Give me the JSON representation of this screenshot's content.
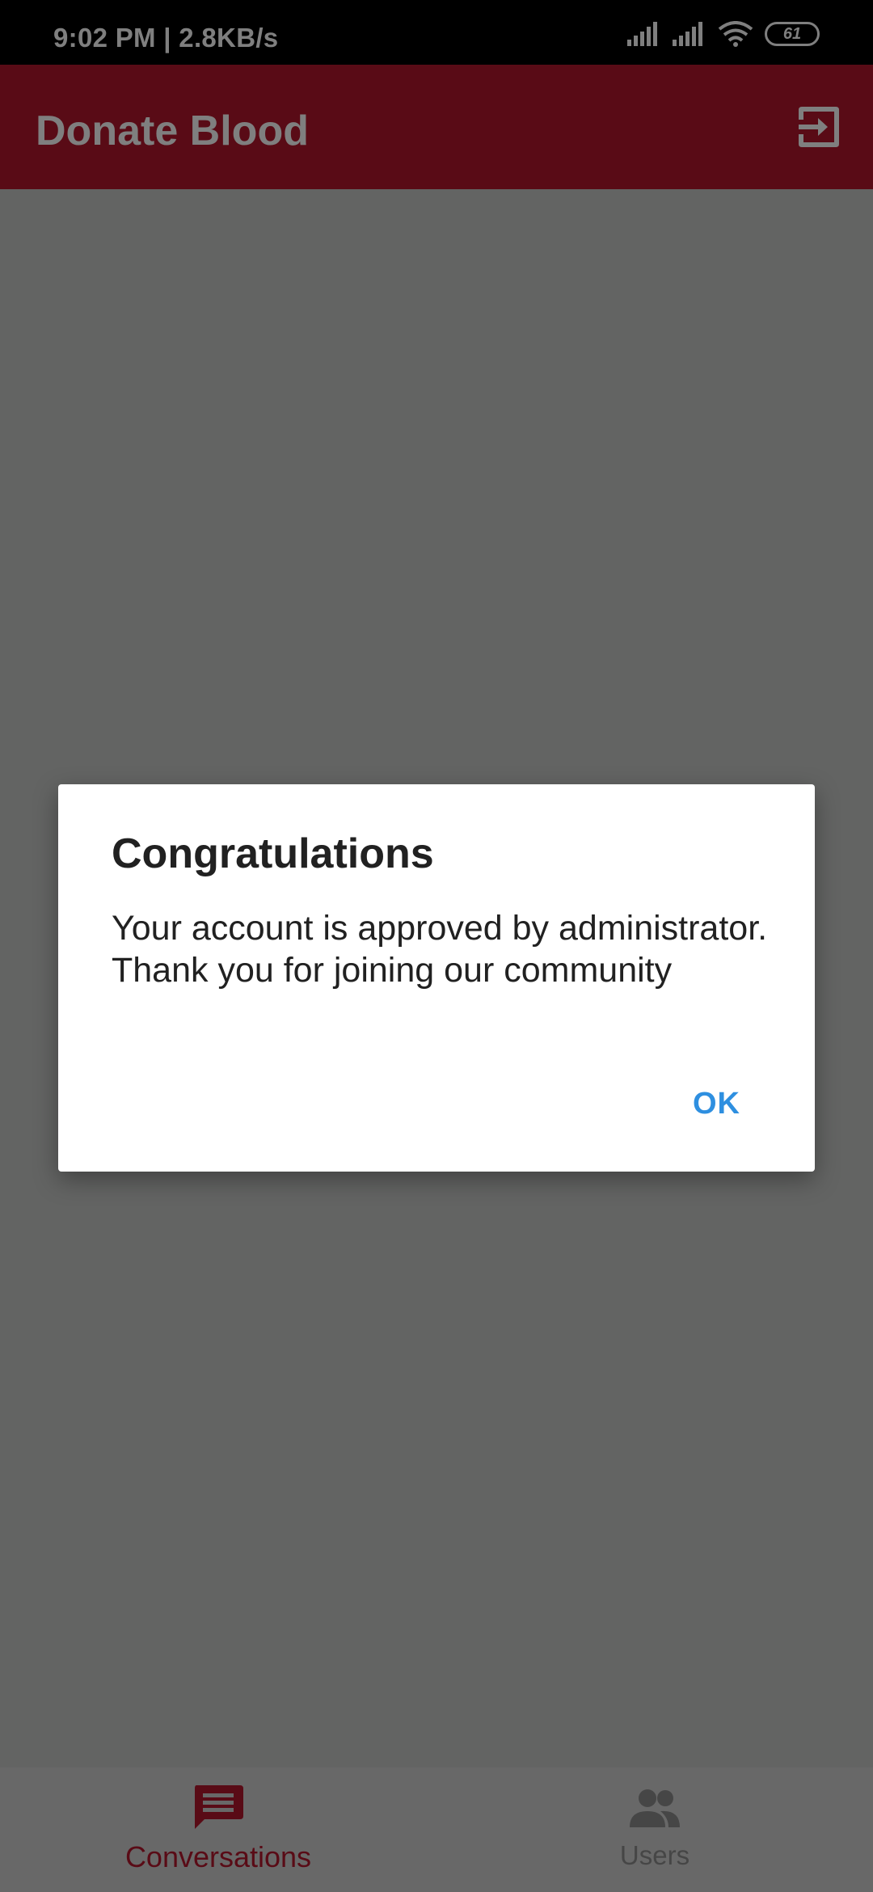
{
  "status_bar": {
    "time": "9:02 PM | 2.8KB/s",
    "battery": "61",
    "icons": [
      "signal-icon",
      "signal-icon",
      "wifi-icon",
      "battery-icon"
    ]
  },
  "app_bar": {
    "title": "Donate Blood",
    "action_icon": "logout-icon",
    "color": "#b3162c"
  },
  "bottom_nav": {
    "items": [
      {
        "label": "Conversations",
        "icon": "chat-icon",
        "active": true
      },
      {
        "label": "Users",
        "icon": "people-icon",
        "active": false
      }
    ]
  },
  "dialog": {
    "title": "Congratulations",
    "message": "Your account is approved by administrator. Thank you for joining our community",
    "ok_label": "OK",
    "accent": "#2e8fe0"
  }
}
